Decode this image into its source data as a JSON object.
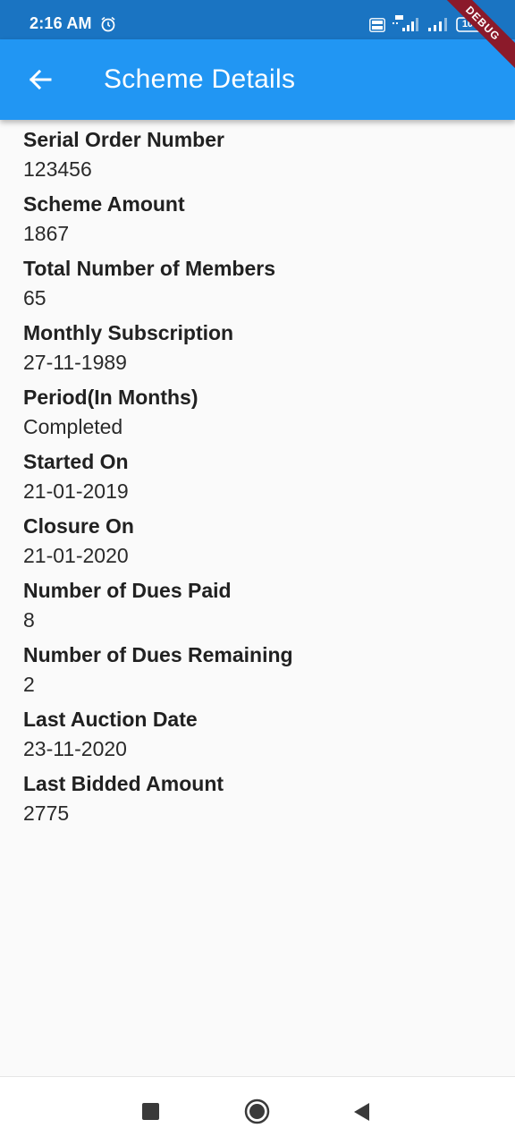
{
  "status_bar": {
    "time": "2:16 AM",
    "battery": "100",
    "icons": [
      "alarm-icon",
      "volte-icon",
      "signal-4g-icon",
      "signal-icon",
      "battery-icon"
    ]
  },
  "app_bar": {
    "title": "Scheme Details",
    "back_icon": "arrow-back-icon",
    "debug_banner": "DEBUG"
  },
  "details": [
    {
      "label": "Serial Order Number",
      "value": "123456"
    },
    {
      "label": "Scheme Amount",
      "value": "1867"
    },
    {
      "label": "Total Number of Members",
      "value": "65"
    },
    {
      "label": "Monthly Subscription",
      "value": "27-11-1989"
    },
    {
      "label": "Period(In Months)",
      "value": "Completed"
    },
    {
      "label": "Started On",
      "value": "21-01-2019"
    },
    {
      "label": "Closure On",
      "value": "21-01-2020"
    },
    {
      "label": "Number of Dues Paid",
      "value": "8"
    },
    {
      "label": "Number of Dues Remaining",
      "value": "2"
    },
    {
      "label": "Last Auction Date",
      "value": "23-11-2020"
    },
    {
      "label": "Last Bidded Amount",
      "value": "2775"
    }
  ],
  "nav_bar": {
    "icons": [
      "recents-square-icon",
      "home-circle-icon",
      "back-triangle-icon"
    ]
  },
  "colors": {
    "status_bar": "#1a74c2",
    "app_bar": "#2196f3",
    "background": "#fafafa",
    "debug_banner": "#8b1a2a"
  }
}
